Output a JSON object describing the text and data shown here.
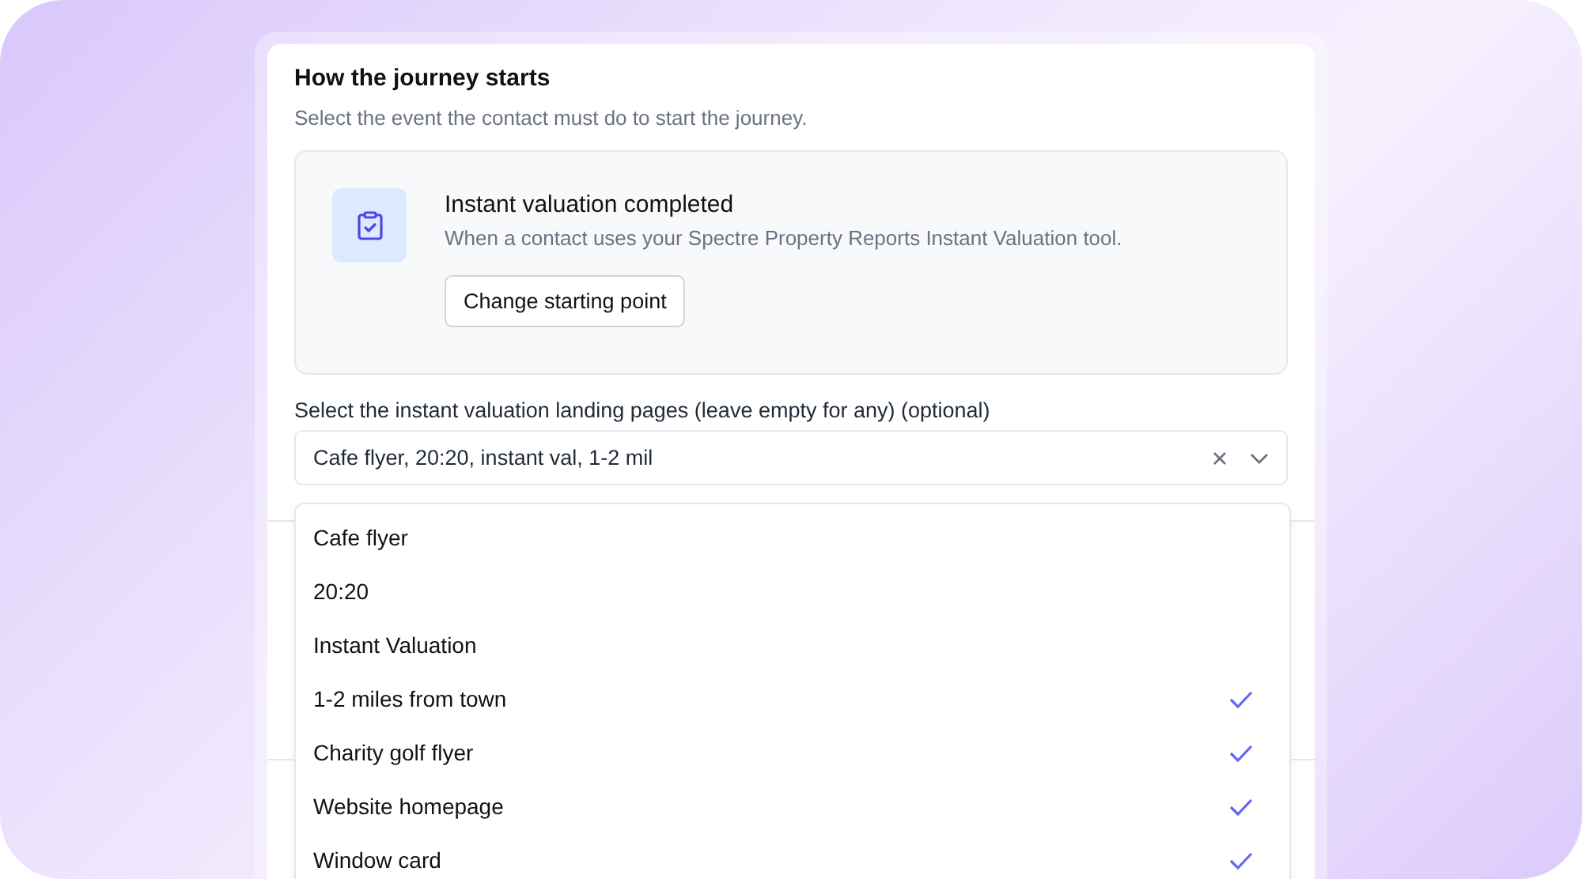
{
  "section": {
    "title": "How the journey starts",
    "subtitle": "Select the event the contact must do to start the journey."
  },
  "trigger": {
    "title": "Instant valuation completed",
    "description": "When a contact uses your Spectre Property Reports Instant Valuation tool.",
    "button": "Change starting point"
  },
  "landing_pages": {
    "label": "Select the instant valuation landing pages (leave empty for any) (optional)",
    "value": "Cafe flyer, 20:20, instant val, 1-2 mil",
    "options": [
      {
        "label": "Cafe flyer",
        "checked": false
      },
      {
        "label": "20:20",
        "checked": false
      },
      {
        "label": "Instant Valuation",
        "checked": false
      },
      {
        "label": "1-2 miles from town",
        "checked": true
      },
      {
        "label": "Charity golf flyer",
        "checked": true
      },
      {
        "label": "Website homepage",
        "checked": true
      },
      {
        "label": "Window card",
        "checked": true
      }
    ]
  }
}
